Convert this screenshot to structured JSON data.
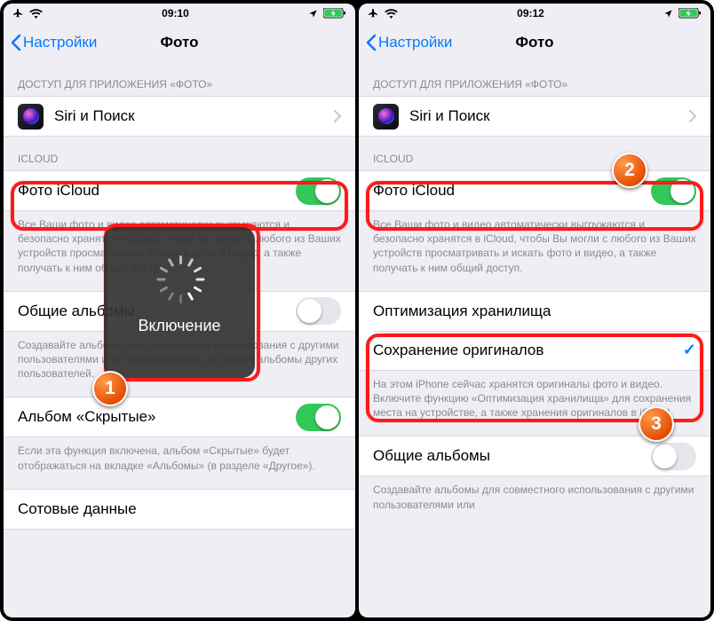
{
  "left": {
    "status": {
      "time": "09:10"
    },
    "nav": {
      "back": "Настройки",
      "title": "Фото"
    },
    "section_app": "ДОСТУП ДЛЯ ПРИЛОЖЕНИЯ «ФОТО»",
    "siri": "Siri и Поиск",
    "section_icloud": "ICLOUD",
    "icloud_photo": "Фото iCloud",
    "icloud_footer": "Все Ваши фото и видео автоматически выгружаются и безопасно хранятся в iCloud, чтобы Вы могли с любого из Ваших устройств просматривать и искать фото и видео, а также получать к ним общий доступ.",
    "shared": "Общие альбомы",
    "shared_footer": "Создавайте альбомы для совместного использования с другими пользователями или подписывайтесь на общие альбомы других пользователей.",
    "hidden": "Альбом «Скрытые»",
    "hidden_footer": "Если эта функция включена, альбом «Скрытые» будет отображаться на вкладке «Альбомы» (в разделе «Другое»).",
    "network_cut": "Сотовые данные",
    "overlay": "Включение",
    "badge": "1"
  },
  "right": {
    "status": {
      "time": "09:12"
    },
    "nav": {
      "back": "Настройки",
      "title": "Фото"
    },
    "section_app": "ДОСТУП ДЛЯ ПРИЛОЖЕНИЯ «ФОТО»",
    "siri": "Siri и Поиск",
    "section_icloud": "ICLOUD",
    "icloud_photo": "Фото iCloud",
    "icloud_footer": "Все Ваши фото и видео автоматически выгружаются и безопасно хранятся в iCloud, чтобы Вы могли с любого из Ваших устройств просматривать и искать фото и видео, а также получать к ним общий доступ.",
    "opt_storage": "Оптимизация хранилища",
    "keep_orig": "Сохранение оригиналов",
    "storage_footer": "На этом iPhone сейчас хранятся оригиналы фото и видео. Включите функцию «Оптимизация хранилища» для сохранения места на устройстве, а также хранения оригиналов в iCloud.",
    "shared": "Общие альбомы",
    "shared_footer": "Создавайте альбомы для совместного использования с другими пользователями или",
    "badge2": "2",
    "badge3": "3"
  }
}
